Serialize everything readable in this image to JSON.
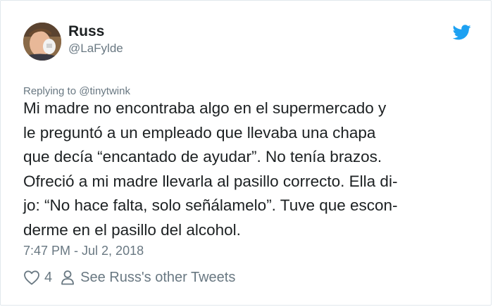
{
  "tweet": {
    "author_name": "Russ",
    "author_handle": "@LaFylde",
    "reply_to": "Replying to @tinytwink",
    "text": "Mi madre no encontraba algo en el supermercado y\nle preguntó a un empleado que llevaba una chapa\nque decía “encantado de ayudar”. No tenía brazos.\nOfreció a mi madre llevarla al pasillo correcto. Ella di-\njo: “No hace falta, solo señálamelo”. Tuve que escon-\nderme en el pasillo del alcohol.",
    "timestamp": "7:47 PM - Jul 2, 2018",
    "like_count": "4",
    "other_tweets_link": "See Russ's other Tweets"
  },
  "icons": {
    "brand": "twitter-bird-icon",
    "like": "heart-icon",
    "profile": "person-icon"
  },
  "colors": {
    "twitter_blue": "#1da1f2",
    "text_primary": "#1c2022",
    "text_secondary": "#697882",
    "border": "#e1e8ed"
  }
}
